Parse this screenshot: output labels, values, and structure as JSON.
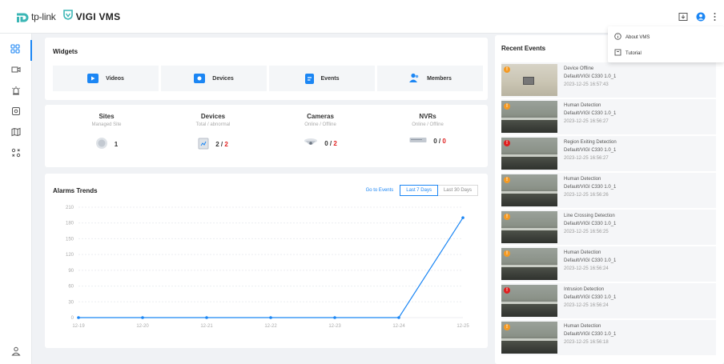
{
  "app": {
    "brand": "tp-link",
    "product": "VIGI VMS"
  },
  "colors": {
    "accent": "#1b86f4",
    "alarm_red": "#e02020",
    "warn_orange": "#f59a23"
  },
  "dropdown": {
    "about": "About VMS",
    "tutorial": "Tutorial"
  },
  "widgets": {
    "title": "Widgets",
    "items": [
      {
        "label": "Videos",
        "icon": "video-icon"
      },
      {
        "label": "Devices",
        "icon": "camera-icon"
      },
      {
        "label": "Events",
        "icon": "events-icon"
      },
      {
        "label": "Members",
        "icon": "members-icon"
      }
    ]
  },
  "stats": {
    "sites": {
      "title": "Sites",
      "sub": "Managed Site",
      "value": "1"
    },
    "devices": {
      "title": "Devices",
      "sub": "Total / abnormal",
      "total": "2",
      "abnormal": "2"
    },
    "cameras": {
      "title": "Cameras",
      "sub": "Online / Offline",
      "online": "0",
      "offline": "2"
    },
    "nvrs": {
      "title": "NVRs",
      "sub": "Online / Offline",
      "online": "0",
      "offline": "0"
    }
  },
  "trends": {
    "title": "Alarms Trends",
    "go_to_events": "Go to Events",
    "last7": "Last 7 Days",
    "last30": "Last 30 Days"
  },
  "chart_data": {
    "type": "line",
    "categories": [
      "12-19",
      "12-20",
      "12-21",
      "12-22",
      "12-23",
      "12-24",
      "12-25"
    ],
    "values": [
      0,
      0,
      0,
      0,
      0,
      0,
      190
    ],
    "y_ticks": [
      "0",
      "30",
      "60",
      "90",
      "120",
      "150",
      "180",
      "210"
    ],
    "ylim": [
      0,
      210
    ],
    "color": "#1b86f4",
    "grid": true
  },
  "events": {
    "title": "Recent Events",
    "items": [
      {
        "type": "Device Offline",
        "device": "Default/VIGI C330 1.0_1",
        "time": "2023-12-25 16:57:43",
        "badge_color": "#f59a23",
        "badge": "!"
      },
      {
        "type": "Human Detection",
        "device": "Default/VIGI C330 1.0_1",
        "time": "2023-12-25 16:56:27",
        "badge_color": "#f59a23",
        "badge": "!"
      },
      {
        "type": "Region Exiting Detection",
        "device": "Default/VIGI C330 1.0_1",
        "time": "2023-12-25 16:56:27",
        "badge_color": "#e02020",
        "badge": "!"
      },
      {
        "type": "Human Detection",
        "device": "Default/VIGI C330 1.0_1",
        "time": "2023-12-25 16:56:26",
        "badge_color": "#f59a23",
        "badge": "!"
      },
      {
        "type": "Line Crossing Detection",
        "device": "Default/VIGI C330 1.0_1",
        "time": "2023-12-25 16:56:25",
        "badge_color": "#f59a23",
        "badge": "!"
      },
      {
        "type": "Human Detection",
        "device": "Default/VIGI C330 1.0_1",
        "time": "2023-12-25 16:56:24",
        "badge_color": "#f59a23",
        "badge": "!"
      },
      {
        "type": "Intrusion Detection",
        "device": "Default/VIGI C330 1.0_1",
        "time": "2023-12-25 16:56:24",
        "badge_color": "#e02020",
        "badge": "!"
      },
      {
        "type": "Human Detection",
        "device": "Default/VIGI C330 1.0_1",
        "time": "2023-12-25 16:56:18",
        "badge_color": "#f59a23",
        "badge": "!"
      }
    ]
  }
}
